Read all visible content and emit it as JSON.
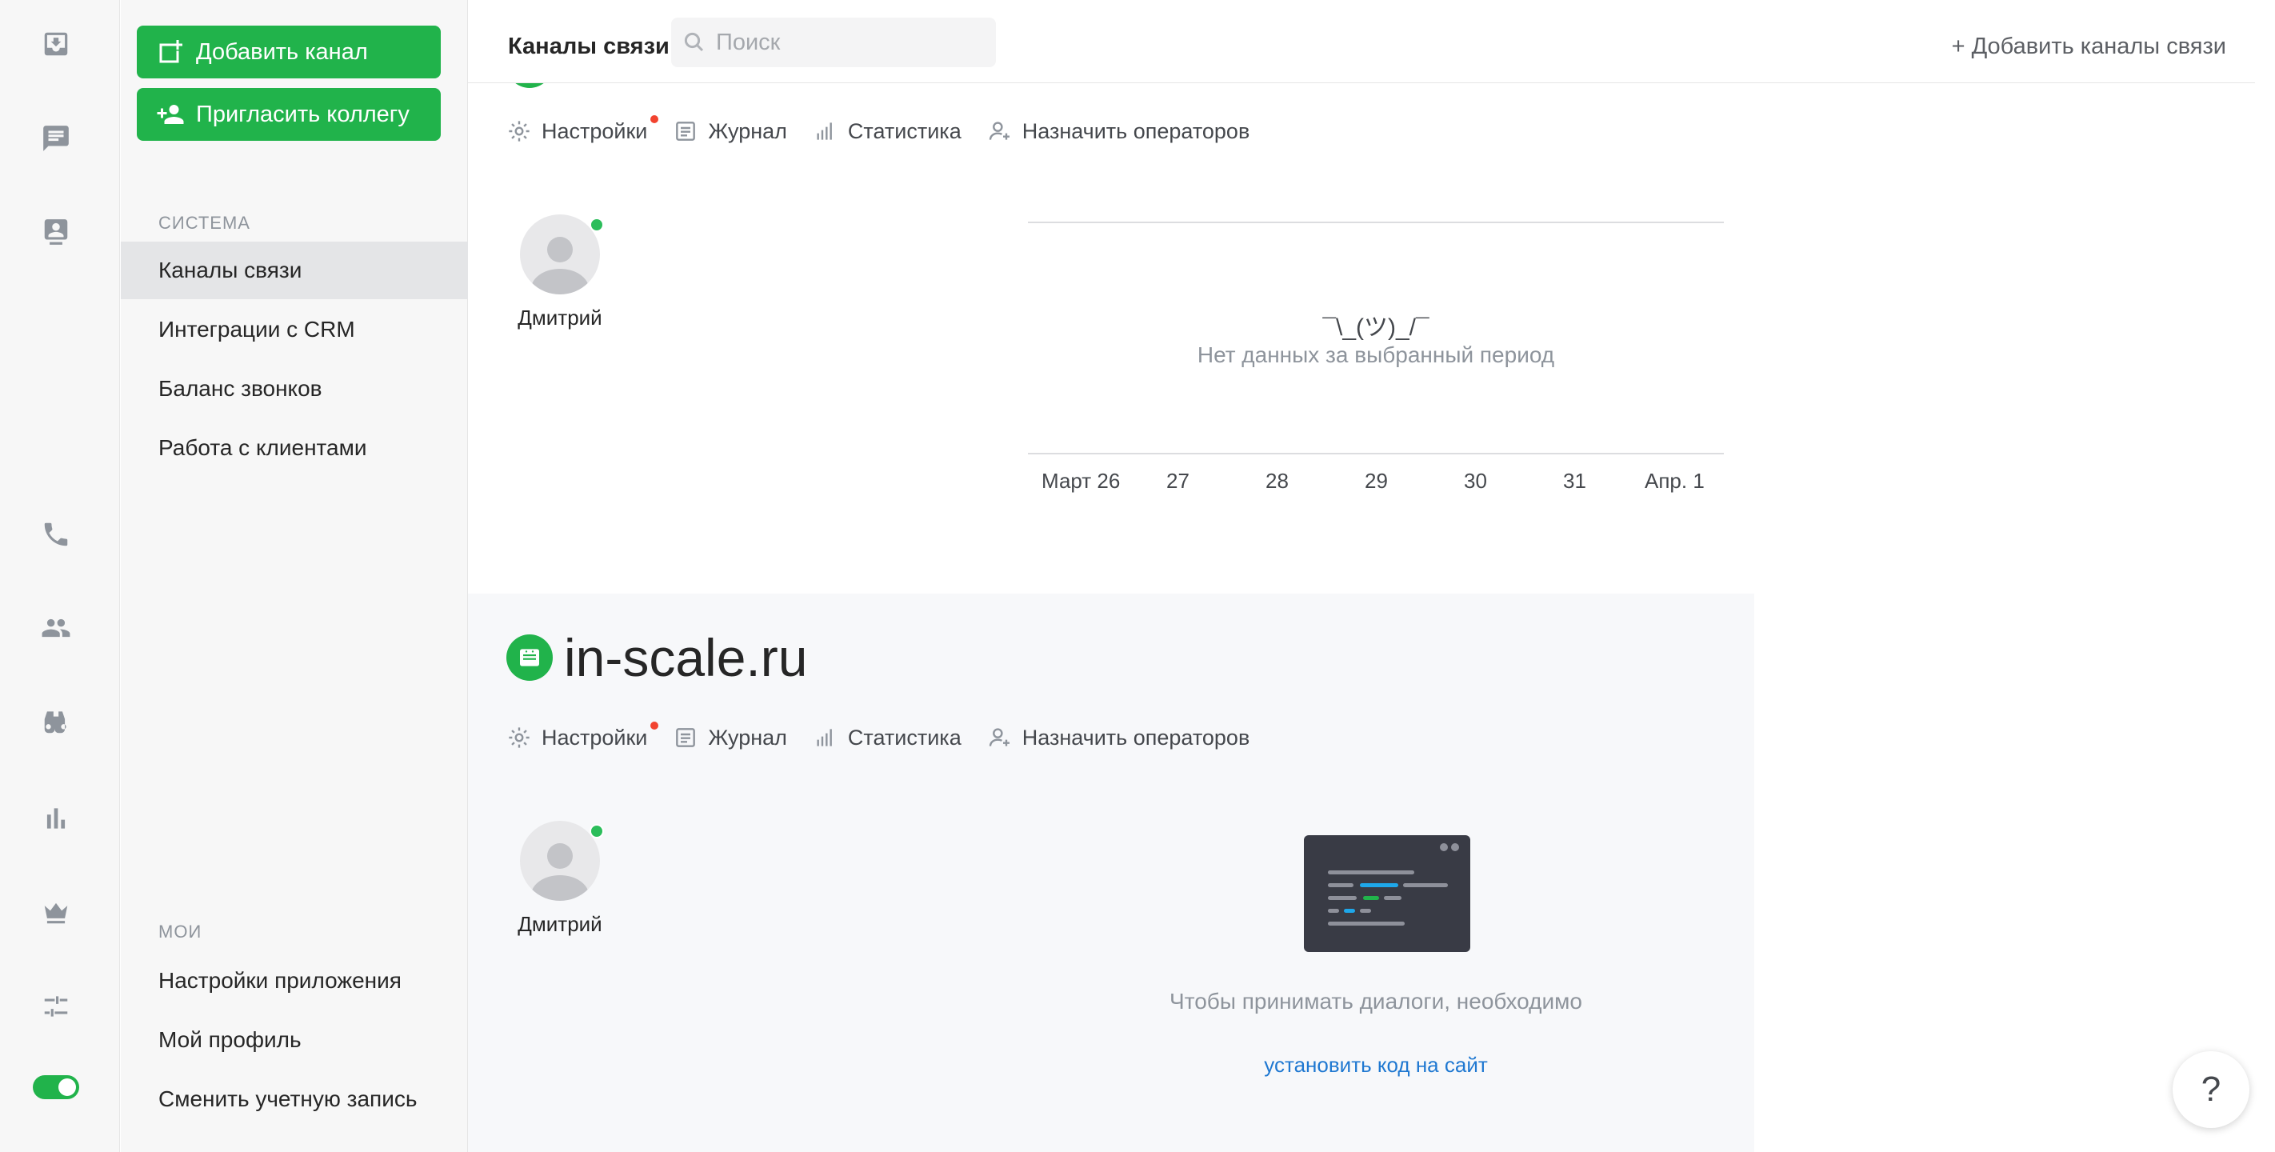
{
  "rail": {
    "icons": [
      "inbox-icon",
      "chat-icon",
      "contact-card-icon",
      "phone-icon",
      "team-icon",
      "binoculars-icon",
      "stats-icon",
      "crown-icon",
      "sliders-icon"
    ],
    "toggle_on": true
  },
  "sidebar": {
    "add_channel_label": "Добавить канал",
    "invite_colleague_label": "Пригласить коллегу",
    "system_section": "СИСТЕМА",
    "system_items": [
      {
        "label": "Каналы связи",
        "active": true
      },
      {
        "label": "Интеграции с CRM",
        "active": false
      },
      {
        "label": "Баланс звонков",
        "active": false
      },
      {
        "label": "Работа с клиентами",
        "active": false
      }
    ],
    "my_section": "МОИ",
    "my_items": [
      {
        "label": "Настройки приложения"
      },
      {
        "label": "Мой профиль"
      },
      {
        "label": "Сменить учетную запись"
      }
    ]
  },
  "header": {
    "title": "Каналы связи",
    "search_placeholder": "Поиск",
    "add_channels_label": "+ Добавить каналы связи"
  },
  "channels": [
    {
      "title": "",
      "tabs": {
        "settings": "Настройки",
        "journal": "Журнал",
        "stats": "Статистика",
        "assign": "Назначить операторов"
      },
      "operator": {
        "name": "Дмитрий",
        "online": true
      },
      "chart": {
        "shrug": "¯\\_(ツ)_/¯",
        "no_data": "Нет данных за выбранный период",
        "ticks": [
          "Март 26",
          "27",
          "28",
          "29",
          "30",
          "31",
          "Апр. 1"
        ]
      }
    },
    {
      "title": "in-scale.ru",
      "tabs": {
        "settings": "Настройки",
        "journal": "Журнал",
        "stats": "Статистика",
        "assign": "Назначить операторов"
      },
      "operator": {
        "name": "Дмитрий",
        "online": true
      },
      "hint": "Чтобы принимать диалоги, необходимо",
      "hint_link": "установить код на сайт"
    }
  ],
  "help_label": "?",
  "colors": {
    "accent_green": "#21b34b",
    "link_blue": "#1f78d1",
    "notification_red": "#f2432f"
  }
}
